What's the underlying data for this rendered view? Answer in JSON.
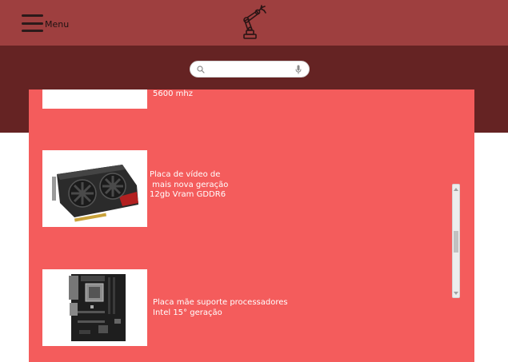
{
  "header": {
    "menu_label": "Menu",
    "menu_icon": "hamburger-icon",
    "logo_icon": "robot-arm-logo-icon"
  },
  "search": {
    "placeholder": "",
    "value": "",
    "search_icon": "search-icon",
    "mic_icon": "microphone-icon"
  },
  "products": [
    {
      "description": "5600 mhz",
      "image": "product-image-partial"
    },
    {
      "description": "Placa de vídeo de\n mais nova geração\n12gb Vram GDDR6",
      "image": "graphics-card-image"
    },
    {
      "description": "Placa mãe suporte processadores\nIntel 15° geração",
      "image": "motherboard-image"
    }
  ],
  "colors": {
    "header": "#9e3f3f",
    "search_band": "#652323",
    "panel": "#f45c5c",
    "text": "#ffffff"
  },
  "scrollbar": {
    "position": 0.4
  }
}
